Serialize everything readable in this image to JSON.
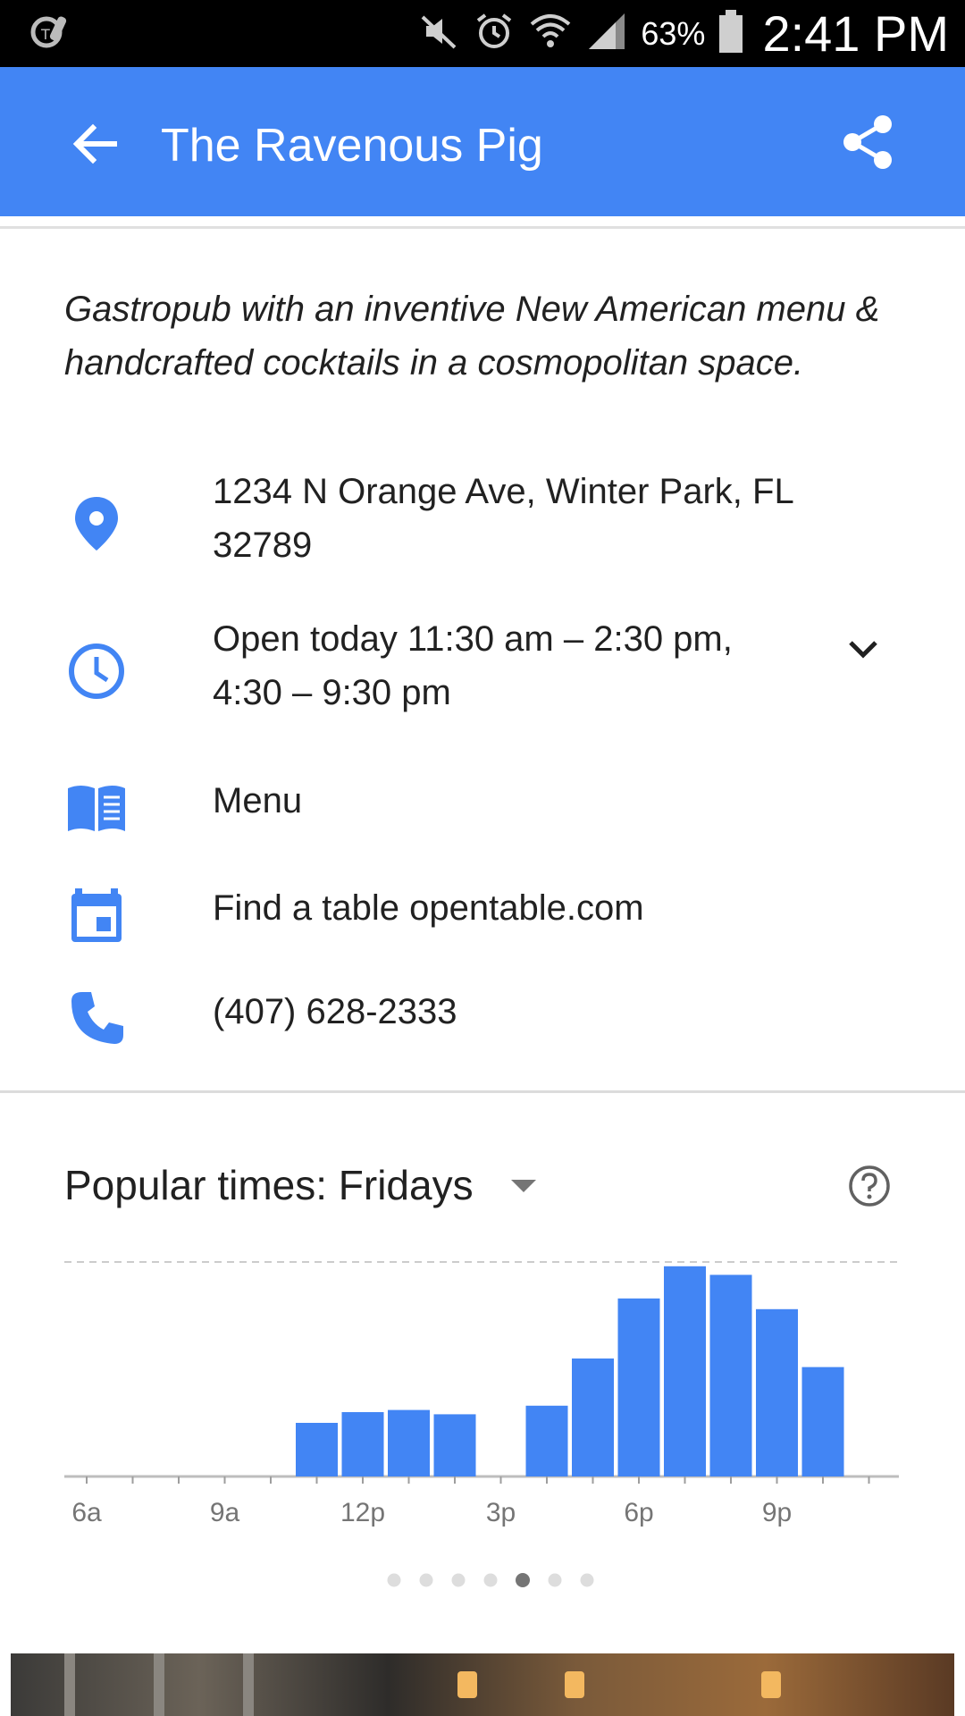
{
  "status_bar": {
    "battery": "63%",
    "time": "2:41 PM",
    "icons": [
      "carrier-icon",
      "mute-icon",
      "alarm-icon",
      "wifi-icon",
      "signal-icon",
      "battery-icon"
    ]
  },
  "app_bar": {
    "title": "The Ravenous Pig",
    "color": "#4285f4",
    "icons": [
      "back-arrow-icon",
      "share-icon"
    ]
  },
  "description": "Gastropub with an inventive New American menu & handcrafted cocktails in a cosmopolitan space.",
  "info": {
    "address": {
      "line1": "1234 N Orange Ave, Winter Park, FL",
      "line2": "32789",
      "icon": "location-pin-icon"
    },
    "hours": {
      "line1": "Open today 11:30 am – 2:30 pm,",
      "line2": "4:30 – 9:30 pm",
      "icon": "clock-icon"
    },
    "menu": {
      "label": "Menu",
      "icon": "menu-book-icon"
    },
    "reserve": {
      "label": "Find a table opentable.com",
      "icon": "calendar-icon"
    },
    "phone": {
      "label": "(407) 628-2333",
      "icon": "phone-icon"
    }
  },
  "popular_times": {
    "title": "Popular times: Fridays",
    "page_count": 7,
    "active_page": 5
  },
  "chart_data": {
    "type": "bar",
    "title": "",
    "xlabel": "",
    "ylabel": "",
    "tick_labels": [
      "6a",
      "9a",
      "12p",
      "3p",
      "6p",
      "9p"
    ],
    "categories": [
      "6a",
      "7a",
      "8a",
      "9a",
      "10a",
      "11a",
      "12p",
      "1p",
      "2p",
      "3p",
      "4p",
      "5p",
      "6p",
      "7p",
      "8p",
      "9p",
      "10p",
      "11p"
    ],
    "values": [
      0,
      0,
      0,
      0,
      0,
      25,
      30,
      31,
      29,
      0,
      33,
      55,
      83,
      98,
      94,
      78,
      51,
      0
    ],
    "ylim": [
      0,
      100
    ],
    "bar_color": "#4285f4",
    "grid": "dashed top line"
  }
}
